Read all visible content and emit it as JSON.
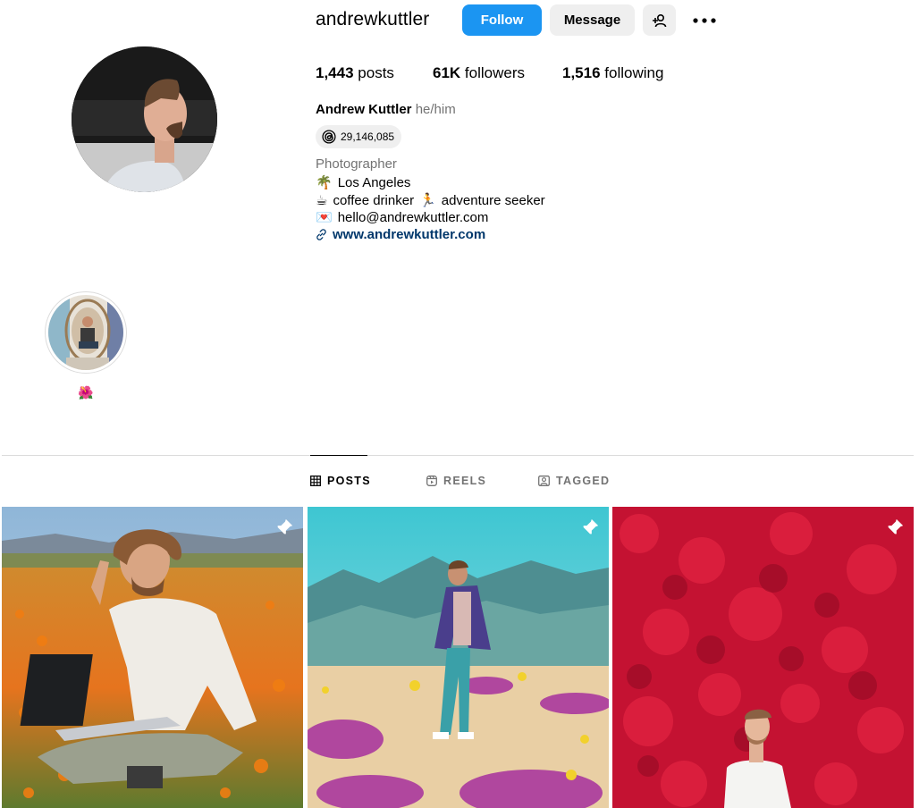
{
  "profile": {
    "username": "andrewkuttler",
    "follow_label": "Follow",
    "message_label": "Message",
    "stats": {
      "posts_count": "1,443",
      "posts_label": "posts",
      "followers_count": "61K",
      "followers_label": "followers",
      "following_count": "1,516",
      "following_label": "following"
    },
    "full_name": "Andrew Kuttler",
    "pronouns": "he/him",
    "threads_count": "29,146,085",
    "category": "Photographer",
    "bio_lines": [
      {
        "emoji": "🌴",
        "text": "Los Angeles"
      },
      {
        "emoji": "☕",
        "text": "coffee drinker",
        "emoji2": "🏃",
        "text2": "adventure seeker"
      },
      {
        "emoji": "💌",
        "text": "hello@andrewkuttler.com"
      }
    ],
    "link": "www.andrewkuttler.com"
  },
  "highlights": [
    {
      "label_emoji": "🌺"
    }
  ],
  "tabs": [
    {
      "label": "POSTS",
      "icon": "grid-icon",
      "active": true
    },
    {
      "label": "REELS",
      "icon": "reels-icon",
      "active": false
    },
    {
      "label": "TAGGED",
      "icon": "tagged-icon",
      "active": false
    }
  ],
  "posts": [
    {
      "pinned": true,
      "scene": "poppy-field-laptop"
    },
    {
      "pinned": true,
      "scene": "desert-flowers-mountains"
    },
    {
      "pinned": true,
      "scene": "red-flower-wall"
    }
  ],
  "colors": {
    "accent": "#1b95f2",
    "link": "#00376b",
    "secondary_text": "#737373",
    "divider": "#dbdbdb"
  }
}
